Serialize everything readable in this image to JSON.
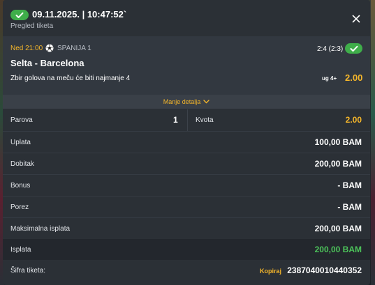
{
  "header": {
    "datetime": "09.11.2025. | 10:47:52`",
    "subtitle": "Pregled tiketa"
  },
  "match": {
    "time": "Ned 21:00",
    "league": "SPANIJA 1",
    "score": "2:4 (2:3)",
    "teams": "Selta - Barcelona",
    "bet": "Zbir golova na meču će biti najmanje 4",
    "bet_code": "ug 4+",
    "odds": "2.00"
  },
  "toggle": {
    "label": "Manje detalja"
  },
  "details": {
    "parova_label": "Parova",
    "parova_value": "1",
    "kvota_label": "Kvota",
    "kvota_value": "2.00",
    "uplata_label": "Uplata",
    "uplata_value": "100,00 BAM",
    "dobitak_label": "Dobitak",
    "dobitak_value": "200,00 BAM",
    "bonus_label": "Bonus",
    "bonus_value": "- BAM",
    "porez_label": "Porez",
    "porez_value": "- BAM",
    "maks_label": "Maksimalna isplata",
    "maks_value": "200,00 BAM",
    "isplata_label": "Isplata",
    "isplata_value": "200,00 BAM",
    "sifra_label": "Šifra tiketa:",
    "kopiraj_label": "Kopiraj",
    "sifra_value": "2387040010440352"
  },
  "colors": {
    "accent": "#f5b62a",
    "success": "#3fae4a",
    "payout": "#4cc45a",
    "panel": "#2b3036"
  }
}
